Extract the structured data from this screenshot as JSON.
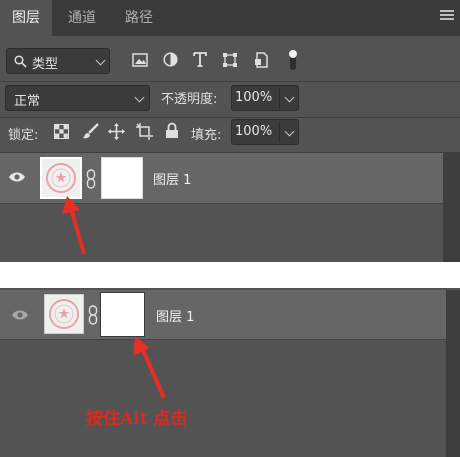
{
  "tabs": [
    {
      "label": "图层",
      "active": true
    },
    {
      "label": "通道",
      "active": false
    },
    {
      "label": "路径",
      "active": false
    }
  ],
  "filter": {
    "label": "类型",
    "icon": "search-icon"
  },
  "filter_icons": [
    "image-filter-icon",
    "adjustment-filter-icon",
    "type-filter-icon",
    "shape-filter-icon",
    "smart-object-filter-icon",
    "filter-toggle-icon"
  ],
  "blend": {
    "mode": "正常",
    "opacity_label": "不透明度:",
    "opacity_value": "100%"
  },
  "lock": {
    "label": "锁定:",
    "fill_label": "填充:",
    "fill_value": "100%"
  },
  "lock_icons": [
    "lock-transparent-icon",
    "lock-paint-icon",
    "lock-position-icon",
    "lock-artboard-icon",
    "lock-all-icon"
  ],
  "layer_top": {
    "name": "图层 1"
  },
  "layer_bottom": {
    "name": "图层 1"
  },
  "annotation": {
    "caption": "按住Alt 点击",
    "color": "#e0281c"
  }
}
